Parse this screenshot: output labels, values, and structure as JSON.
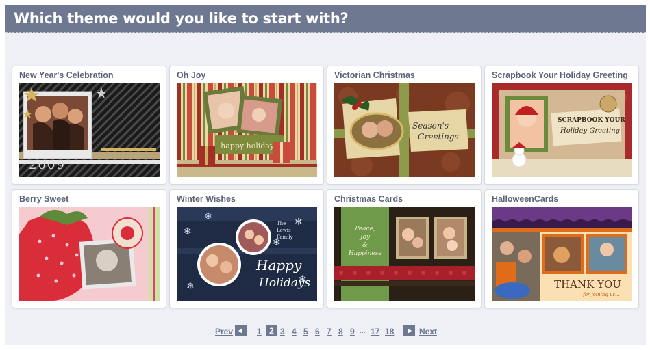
{
  "header": {
    "title": "Which theme would you like to start with?"
  },
  "themes": [
    {
      "title": "New Year's Celebration",
      "thumb_text": [
        "2009"
      ]
    },
    {
      "title": "Oh Joy",
      "thumb_text": [
        "happy holidays"
      ]
    },
    {
      "title": "Victorian Christmas",
      "thumb_text": [
        "Season's",
        "Greetings"
      ]
    },
    {
      "title": "Scrapbook Your Holiday Greeting",
      "thumb_text": [
        "SCRAPBOOK YOUR",
        "Holiday Greeting"
      ]
    },
    {
      "title": "Berry Sweet",
      "thumb_text": []
    },
    {
      "title": "Winter Wishes",
      "thumb_text": [
        "The",
        "Lewis",
        "Family",
        "Happy",
        "Holidays"
      ]
    },
    {
      "title": "Christmas Cards",
      "thumb_text": [
        "Peace,",
        "Joy",
        "&",
        "Happiness"
      ]
    },
    {
      "title": "HalloweenCards",
      "thumb_text": [
        "THANK YOU",
        "for joining us..."
      ]
    }
  ],
  "pagination": {
    "prev_label": "Prev",
    "next_label": "Next",
    "current_page": "2",
    "pages": [
      "1",
      "3",
      "4",
      "5",
      "6",
      "7",
      "8",
      "9"
    ],
    "ellipsis": "...",
    "tail_pages": [
      "17",
      "18"
    ]
  },
  "colors": {
    "header_bg": "#6f7891",
    "panel_bg": "#eef0f5",
    "title_text": "#5e6478"
  }
}
